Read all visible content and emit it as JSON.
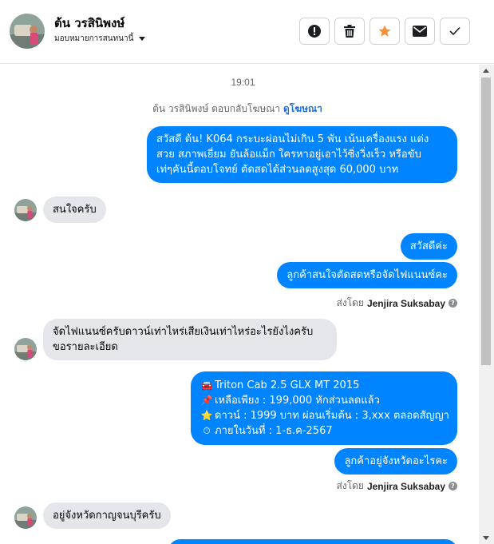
{
  "header": {
    "name": "ต้น วรสินิพงษ์",
    "subtitle": "มอบหมายการสนทนานี้",
    "actions": [
      {
        "icon": "alert-icon",
        "label": "report"
      },
      {
        "icon": "trash-icon",
        "label": "delete"
      },
      {
        "icon": "star-icon",
        "label": "star"
      },
      {
        "icon": "mail-icon",
        "label": "mark unread"
      },
      {
        "icon": "check-icon",
        "label": "done"
      }
    ]
  },
  "colors": {
    "outgoing": "#0084ff",
    "incoming": "#e4e6eb",
    "star": "#f7923b",
    "link": "#216fdb"
  },
  "chat": {
    "time": "19:01",
    "ad_reply_text": "ต้น วรสินิพงษ์ ตอบกลับโฆษณา",
    "ad_link": "ดูโฆษณา",
    "messages": {
      "m1": [
        "สวัสดี ต้น! K064 กระบะผ่อนไม่เกิน 5 พัน เน้นเครื่องแรง แต่ง",
        "สวย สภาพเยี่ยม ยันล้อแม็ก ใครหาอยู่เอาไว้ซิ่งวิ่งเร็ว หรือขับ",
        "เท่ๆคันนี้ตอบโจทย์ ตัดสดได้ส่วนลดสูงสุด 60,000 บาท"
      ],
      "m2": "สนใจครับ",
      "m3": "สวัสดีค่ะ",
      "m4": "ลูกค้าสนใจตัดสดหรือจัดไฟแนนซ์คะ",
      "sentby_label": "ส่งโดย",
      "sender": "Jenjira Suksabay",
      "m5": [
        "จัดไฟแนนซ์ครับดาวน์เท่าไหร่เสียเงินเท่าไหร่อะไรยังไงครับ",
        "ขอรายละเอียด"
      ],
      "m6": [
        {
          "emoji": "🚘",
          "text": "Triton Cab 2.5 GLX MT 2015"
        },
        {
          "emoji": "📌",
          "text": "เหลือเพียง : 199,000 หักส่วนลดแล้ว"
        },
        {
          "emoji": "⭐",
          "text": "ดาวน์ : 1999 บาท ผ่อนเริ่มต้น : 3,xxx ตลอดสัญญา"
        },
        {
          "emoji": "⏱",
          "text": "ภายในวันที่ : 1-ธ.ค-2567"
        }
      ],
      "m7": "ลูกค้าอยู่จังหวัดอะไรคะ",
      "m8": "อยู่จังหวัดกาญจนบุรีครับ"
    }
  }
}
